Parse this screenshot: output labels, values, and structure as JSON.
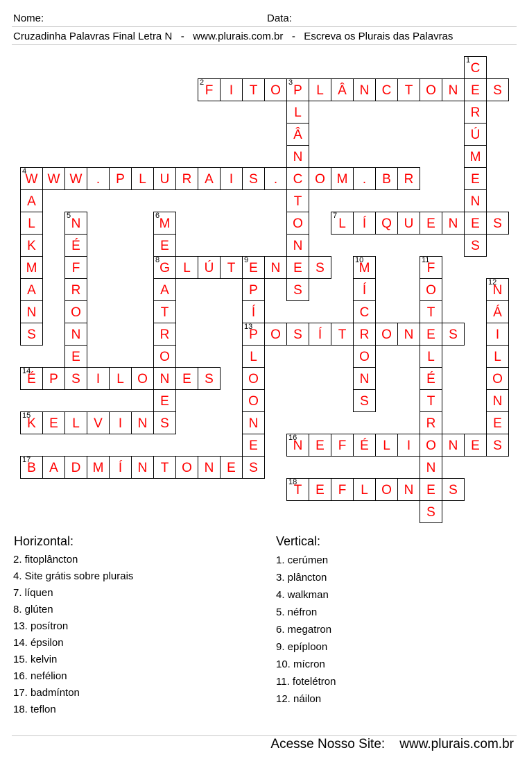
{
  "header": {
    "name_label": "Nome:",
    "date_label": "Data:",
    "subtitle": "Cruzadinha Palavras Final Letra N   -   www.plurais.com.br   -   Escreva os Plurais das Palavras"
  },
  "colors": {
    "letters": "#ff0000",
    "numbers": "#000000",
    "grid_border": "#000000",
    "rule_lines": "#c8c8c8"
  },
  "puzzle": {
    "words": [
      {
        "num": "1",
        "dir": "down",
        "row": 0,
        "col": 20,
        "answer": "CERÚMENES"
      },
      {
        "num": "2",
        "dir": "across",
        "row": 1,
        "col": 8,
        "answer": "FITOPLÂNCTONES"
      },
      {
        "num": "3",
        "dir": "down",
        "row": 1,
        "col": 12,
        "answer": "PLÂNCTONES"
      },
      {
        "num": "4",
        "dir": "across",
        "row": 5,
        "col": 0,
        "answer": "WWW.PLURAIS.COM.BR"
      },
      {
        "num": "4",
        "dir": "down",
        "row": 5,
        "col": 0,
        "answer": "WALKMANS"
      },
      {
        "num": "5",
        "dir": "down",
        "row": 7,
        "col": 2,
        "answer": "NÉFRONES"
      },
      {
        "num": "6",
        "dir": "down",
        "row": 7,
        "col": 6,
        "answer": "MEGATRONES"
      },
      {
        "num": "7",
        "dir": "across",
        "row": 7,
        "col": 14,
        "answer": "LÍQUENES"
      },
      {
        "num": "8",
        "dir": "across",
        "row": 9,
        "col": 6,
        "answer": "GLÚTENES"
      },
      {
        "num": "9",
        "dir": "down",
        "row": 9,
        "col": 10,
        "answer": "EPÍPLOONES"
      },
      {
        "num": "10",
        "dir": "down",
        "row": 9,
        "col": 15,
        "answer": "MÍCRONS"
      },
      {
        "num": "11",
        "dir": "down",
        "row": 9,
        "col": 18,
        "answer": "FOTELÉTRONES"
      },
      {
        "num": "12",
        "dir": "down",
        "row": 10,
        "col": 21,
        "answer": "NÁILONES"
      },
      {
        "num": "13",
        "dir": "across",
        "row": 12,
        "col": 10,
        "answer": "POSÍTRONES"
      },
      {
        "num": "14",
        "dir": "across",
        "row": 14,
        "col": 0,
        "answer": "ÉPSILONES"
      },
      {
        "num": "15",
        "dir": "across",
        "row": 16,
        "col": 0,
        "answer": "KELVINS"
      },
      {
        "num": "16",
        "dir": "across",
        "row": 17,
        "col": 12,
        "answer": "NEFÉLIONES"
      },
      {
        "num": "17",
        "dir": "across",
        "row": 18,
        "col": 0,
        "answer": "BADMÍNTONES"
      },
      {
        "num": "18",
        "dir": "across",
        "row": 19,
        "col": 12,
        "answer": "TEFLONES"
      }
    ]
  },
  "clues": {
    "horizontal_title": "Horizontal:",
    "horizontal": [
      "2.  fitoplâncton",
      "4.  Site grátis sobre plurais",
      "7.  líquen",
      "8.  glúten",
      "13.  posítron",
      "14.  épsilon",
      "15.  kelvin",
      "16.  nefélion",
      "17.  badmínton",
      "18.  teflon"
    ],
    "vertical_title": "Vertical:",
    "vertical": [
      "1.  cerúmen",
      "3.  plâncton",
      "4.  walkman",
      "5.  néfron",
      "6.  megatron",
      "9.  epíploon",
      "10.  mícron",
      "11.  fotelétron",
      "12.  náilon"
    ]
  },
  "footer": {
    "text": "Acesse Nosso Site:    www.plurais.com.br"
  }
}
